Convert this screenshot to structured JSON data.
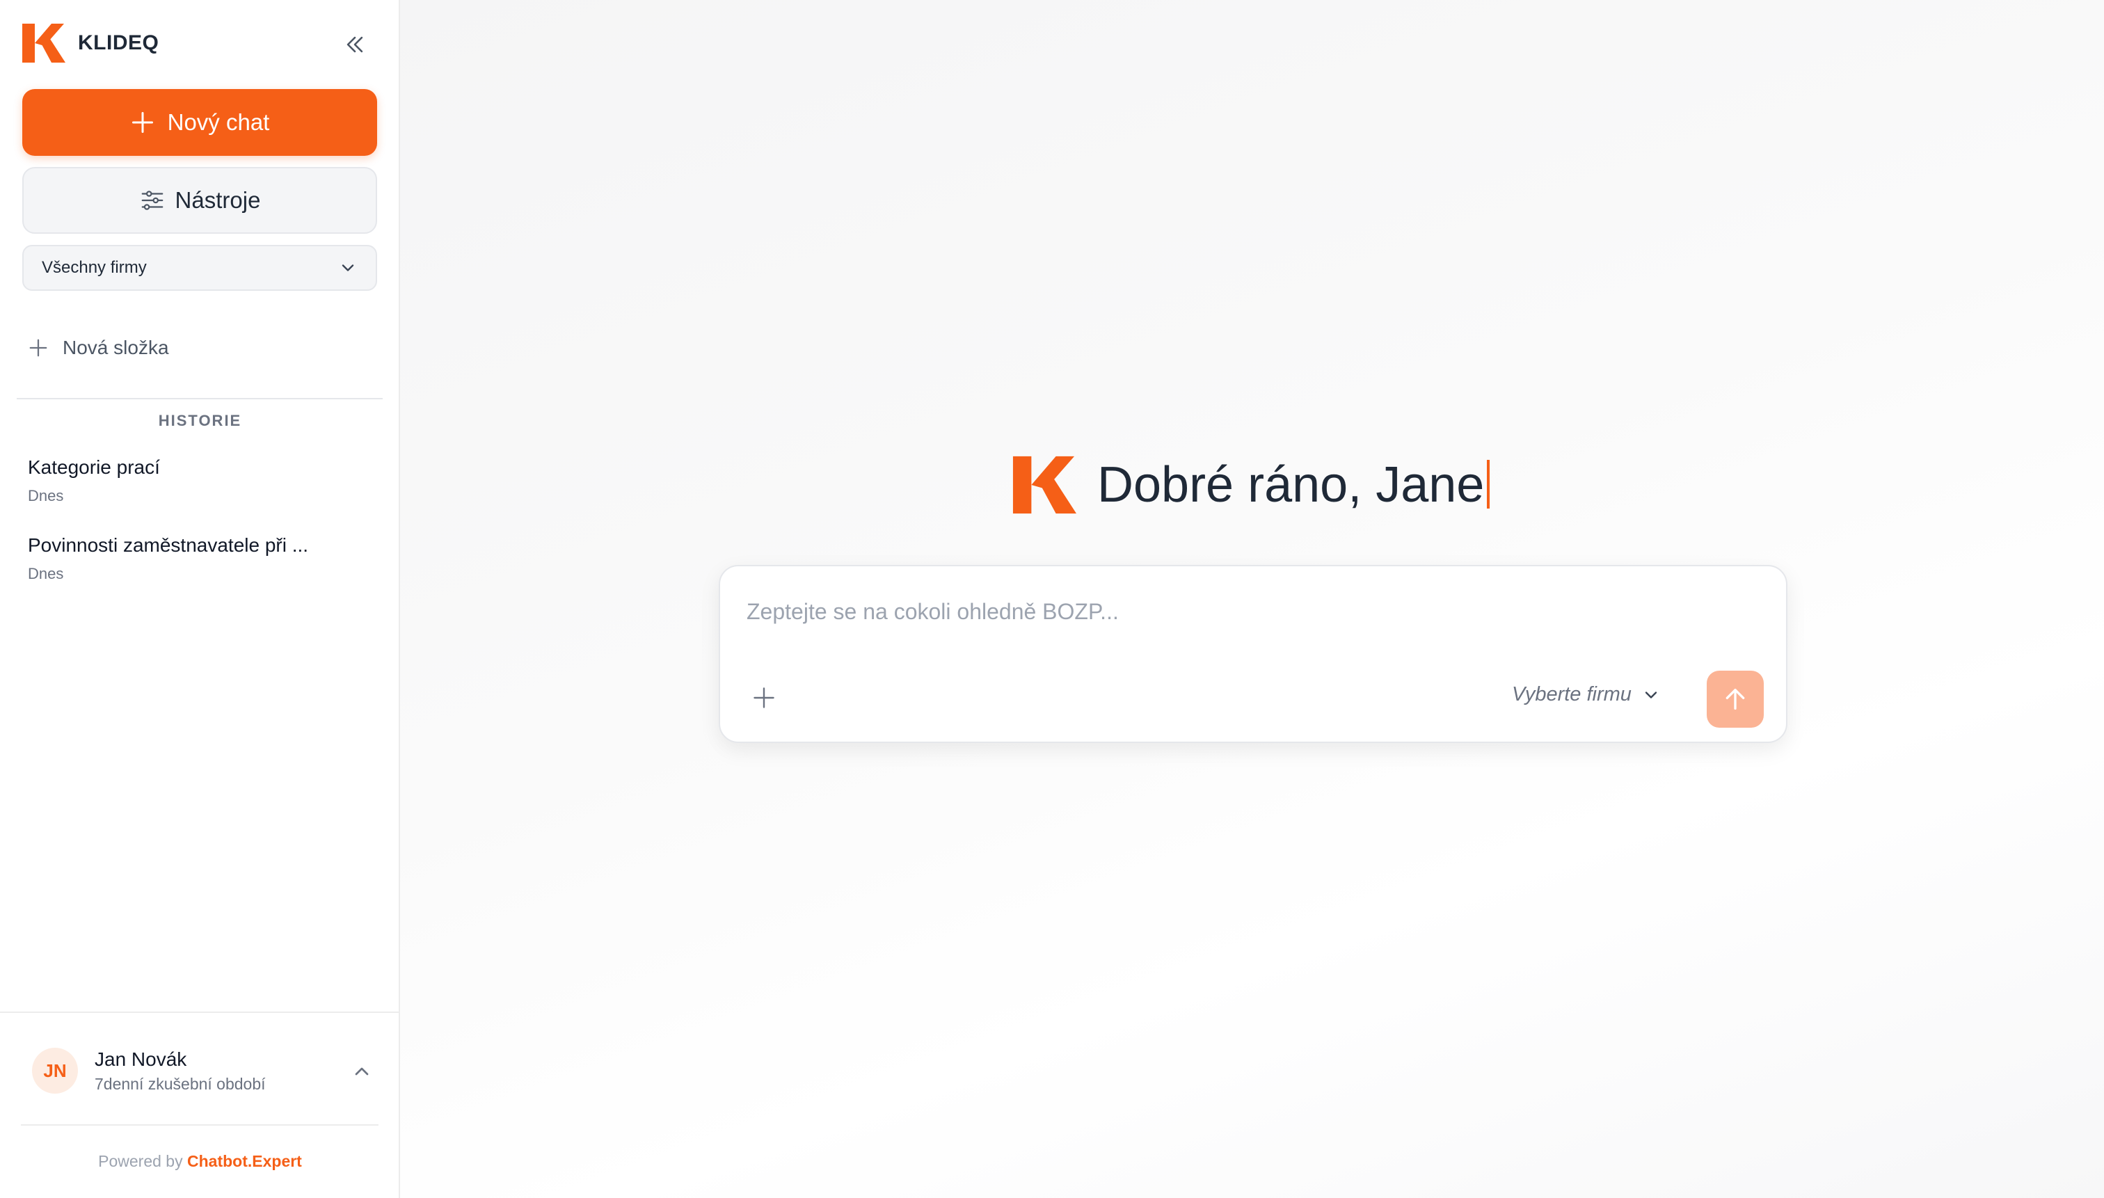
{
  "brand": {
    "name": "KLIDEQ",
    "accent": "#f55f17"
  },
  "sidebar": {
    "new_chat_label": "Nový chat",
    "tools_label": "Nástroje",
    "company_filter": "Všechny firmy",
    "new_folder_label": "Nová složka",
    "history_heading": "HISTORIE",
    "history": [
      {
        "title": "Kategorie prací",
        "date": "Dnes"
      },
      {
        "title": "Povinnosti zaměstnavatele při ...",
        "date": "Dnes"
      }
    ],
    "user": {
      "initials": "JN",
      "name": "Jan Novák",
      "plan": "7denní zkušební období"
    },
    "footer": {
      "powered_by": "Powered by",
      "link_text": "Chatbot.Expert"
    }
  },
  "main": {
    "greeting": "Dobré ráno, Jane",
    "composer": {
      "placeholder": "Zeptejte se na cokoli ohledně BOZP...",
      "company_picker": "Vyberte firmu"
    }
  },
  "icons": {
    "collapse": "double-chevron-left-icon",
    "plus": "plus-icon",
    "tools": "sliders-icon",
    "dropdown": "chevron-down-icon",
    "user_menu": "chevron-up-icon",
    "send": "arrow-up-icon"
  }
}
